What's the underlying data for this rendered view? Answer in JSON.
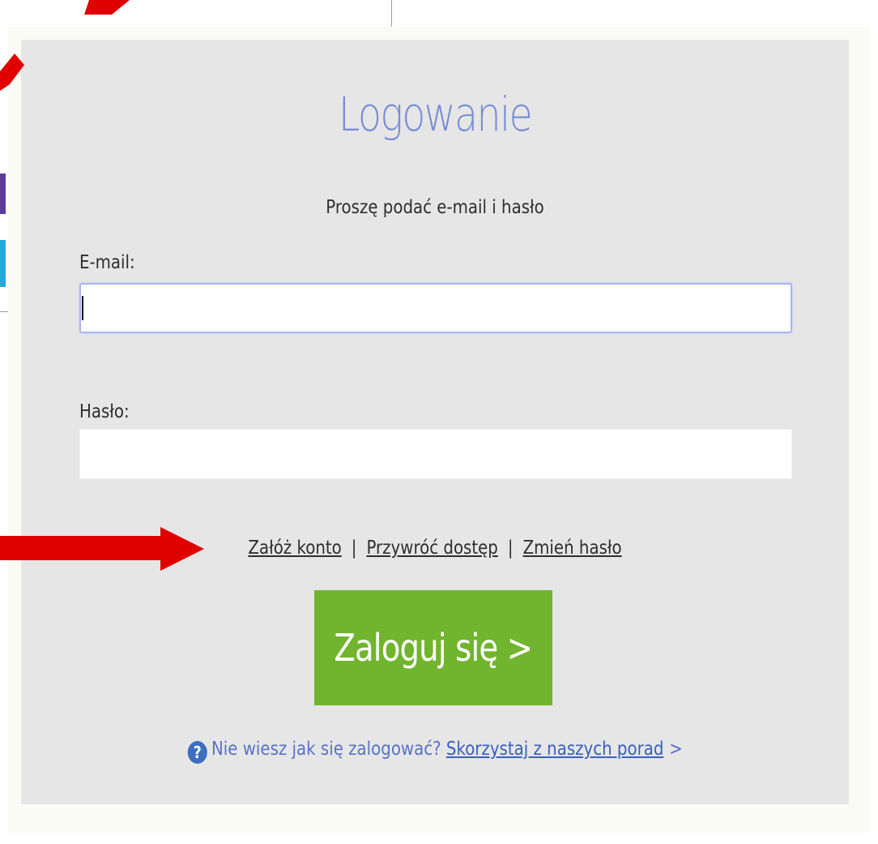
{
  "login": {
    "title": "Logowanie",
    "subtitle": "Proszę podać e-mail i hasło",
    "email_label": "E-mail:",
    "email_value": "",
    "password_label": "Hasło:",
    "password_value": "",
    "links": {
      "create_account": "Załóż konto",
      "separator": "|",
      "restore_access": "Przywróć dostęp",
      "change_password": "Zmień hasło"
    },
    "submit_label": "Zaloguj się >",
    "help": {
      "icon": "question-circle-icon",
      "icon_glyph": "?",
      "question": "Nie wiesz jak się zalogować?",
      "link": "Skorzystaj z naszych porad",
      "chevron": ">"
    }
  },
  "colors": {
    "panel_background": "#e6e6e6",
    "title": "#7a8ed6",
    "login_button": "#71b52f",
    "help_link": "#3a5fc0",
    "annotation_arrow": "#e00000"
  },
  "annotations": {
    "arrow_icon": "red-arrow-icon"
  }
}
